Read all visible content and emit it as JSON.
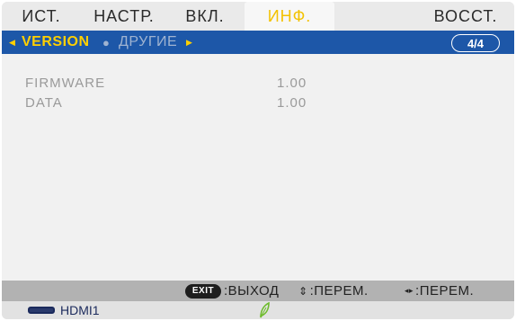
{
  "tabs": [
    {
      "label": "ИСТ.",
      "active": false
    },
    {
      "label": "НАСТР.",
      "active": false
    },
    {
      "label": "ВКЛ.",
      "active": false
    },
    {
      "label": "ИНФ.",
      "active": true
    },
    {
      "label": "ВОССТ.",
      "active": false
    }
  ],
  "subheader": {
    "left_arrow_icon": "triangle-left-icon",
    "current": "VERSION",
    "separator_icon": "dot-icon",
    "other": "ДРУГИЕ",
    "right_arrow_icon": "triangle-right-icon",
    "page": "4/4"
  },
  "info_rows": [
    {
      "label": "FIRMWARE",
      "value": "1.00"
    },
    {
      "label": "DATA",
      "value": "1.00"
    }
  ],
  "help": {
    "exit_key": "EXIT",
    "exit_label": ":ВЫХОД",
    "updown_symbol": "⇕",
    "updown_label": ":ПЕРЕМ.",
    "leftright_symbol": "◂▸",
    "leftright_label": ":ПЕРЕМ."
  },
  "status": {
    "source_icon": "hdmi-icon",
    "source_label": "HDMI1",
    "eco_icon": "leaf-icon"
  },
  "colors": {
    "active_tab_text": "#f3c200",
    "subheader_bg": "#1d57a8",
    "subheader_current": "#ffd000",
    "eco_leaf": "#6dbb2b"
  }
}
